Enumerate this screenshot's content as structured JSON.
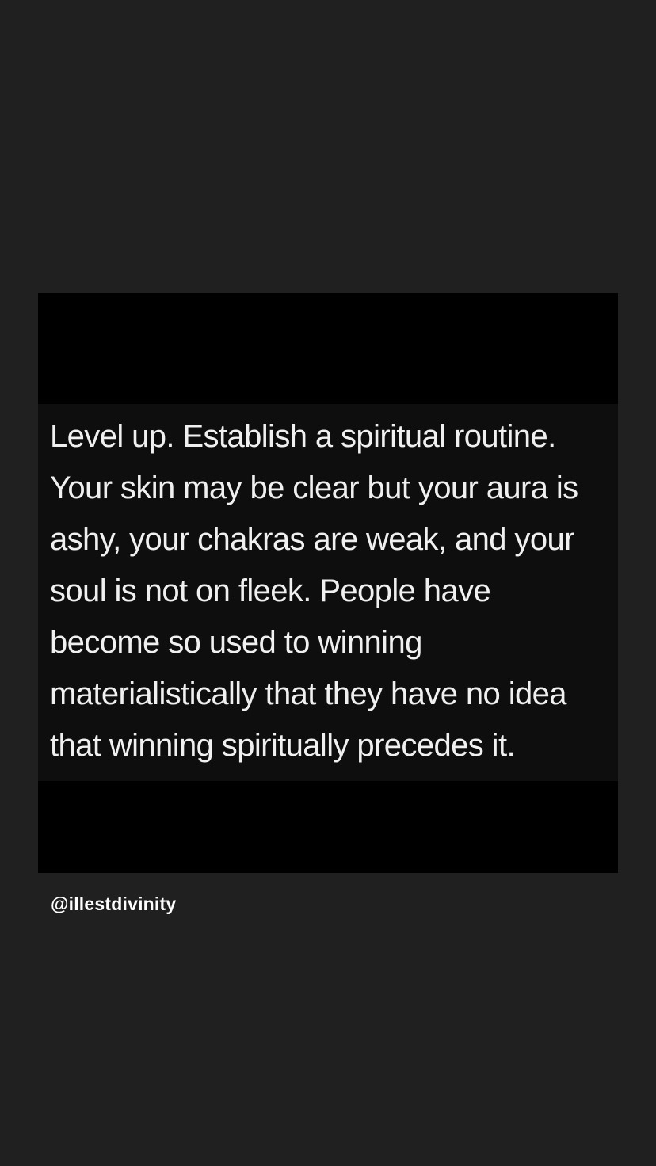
{
  "post": {
    "quote_lines": [
      "Level up. Establish a spiritual routine.",
      "Your skin may be clear but your aura is",
      "ashy, your chakras are weak, and your",
      "soul is not on fleek. People have",
      "become so used to winning",
      "materialistically that they have no idea",
      "that winning spiritually precedes it."
    ]
  },
  "mention": {
    "username": "@illestdivinity"
  },
  "colors": {
    "background": "#202020",
    "card": "#000000",
    "quote_band": "#0e0e0e",
    "text": "#f0f0f0"
  }
}
